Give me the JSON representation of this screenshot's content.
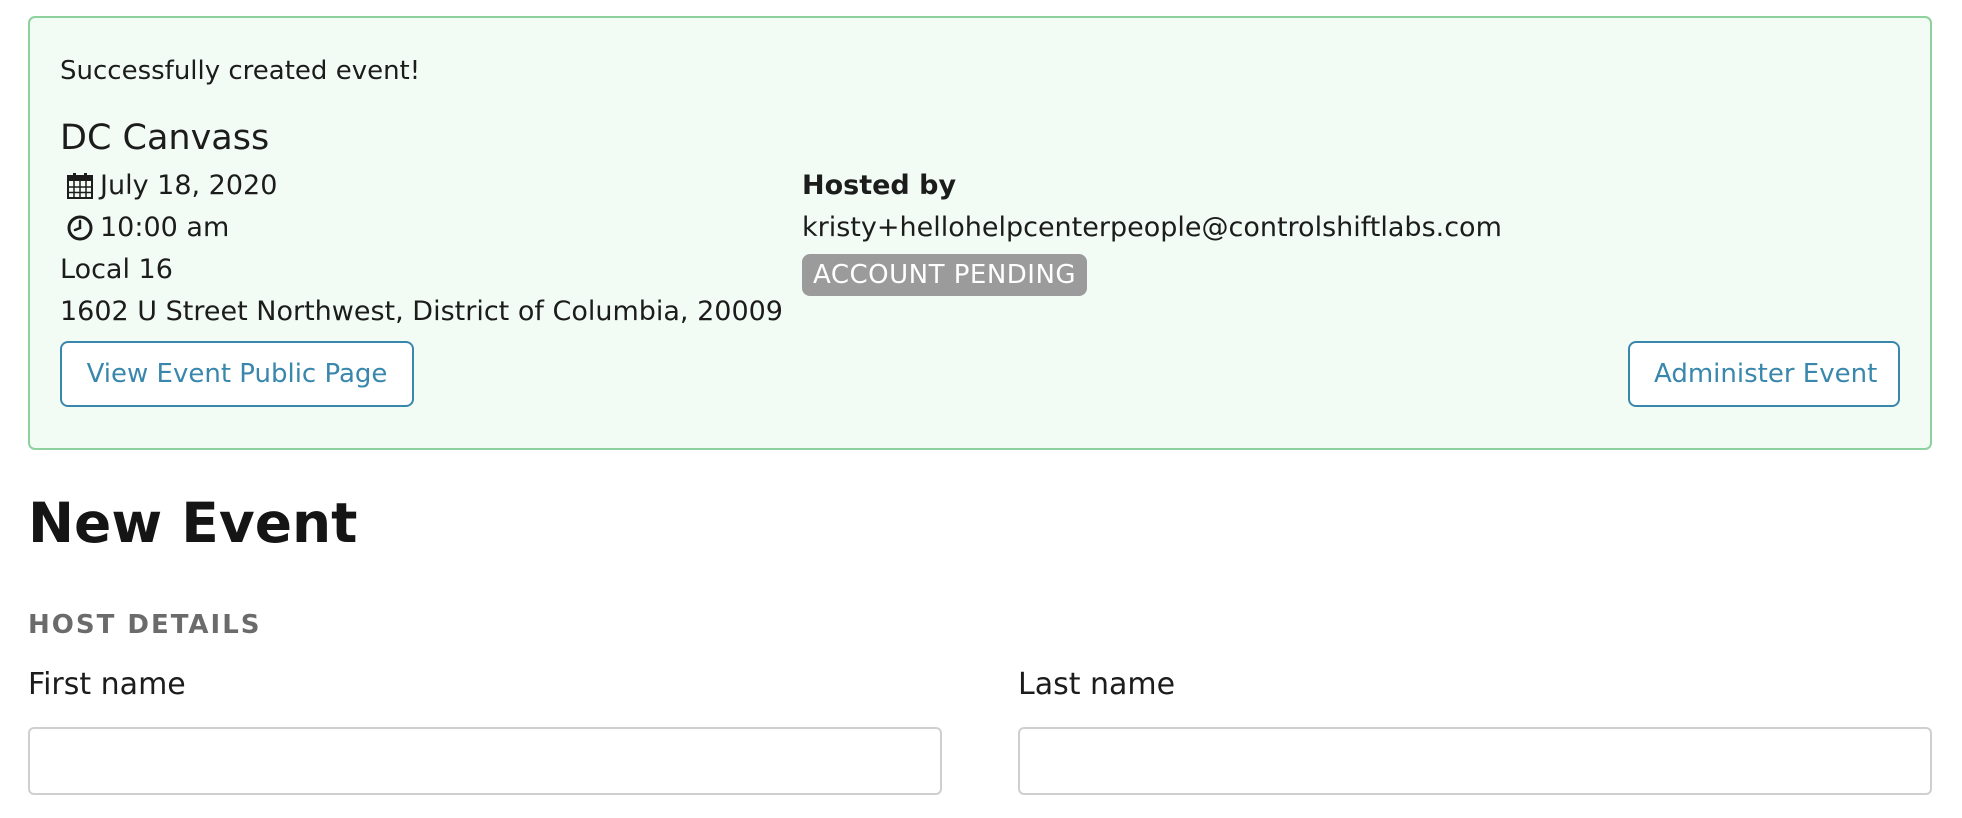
{
  "banner": {
    "message": "Successfully created event!",
    "event": {
      "title": "DC Canvass",
      "date": "July 18, 2020",
      "time": "10:00 am",
      "venue": "Local 16",
      "address": "1602 U Street Northwest, District of Columbia, 20009"
    },
    "host": {
      "heading": "Hosted by",
      "email": "kristy+hellohelpcenterpeople@controlshiftlabs.com",
      "status_badge": "ACCOUNT PENDING"
    },
    "buttons": {
      "view_public": "View Event Public Page",
      "administer": "Administer Event"
    }
  },
  "page": {
    "title": "New Event"
  },
  "form": {
    "section_label": "HOST DETAILS",
    "first_name": {
      "label": "First name",
      "value": "",
      "placeholder": ""
    },
    "last_name": {
      "label": "Last name",
      "value": "",
      "placeholder": ""
    }
  },
  "colors": {
    "banner_bg": "#f2fcf4",
    "banner_border": "#8fd19e",
    "link_blue": "#3a87ad",
    "badge_gray": "#9b9b9b",
    "section_gray": "#6b6b6b"
  },
  "icons": {
    "date": "calendar-icon",
    "time": "clock-icon"
  }
}
